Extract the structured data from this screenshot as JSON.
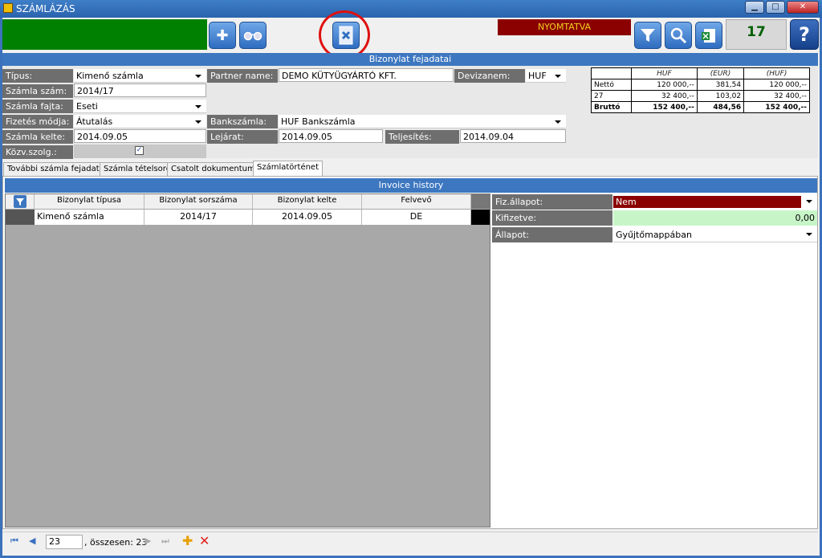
{
  "window": {
    "title": "SZÁMLÁZÁS",
    "min": "▁",
    "max": "□",
    "close": "✕"
  },
  "toolbar": {
    "status": "NYOMTATVA",
    "counter": "17",
    "add_icon": "plus-icon",
    "glasses_icon": "glasses-icon",
    "delete_icon": "delete-document-icon",
    "filter_icon": "filter-icon",
    "search_icon": "search-icon",
    "excel_icon": "excel-icon",
    "help": "?"
  },
  "header": {
    "section_title": "Bizonylat fejadatai",
    "fields": {
      "tipus_label": "Típus:",
      "tipus_value": "Kimenő számla",
      "szamlaszam_label": "Számla szám:",
      "szamlaszam_value": "2014/17",
      "fajta_label": "Számla fajta:",
      "fajta_value": "Eseti",
      "fizetes_label": "Fizetés módja:",
      "fizetes_value": "Átutalás",
      "kelte_label": "Számla kelte:",
      "kelte_value": "2014.09.05",
      "kozv_label": "Közv.szolg.:",
      "kozv_checked": "✓",
      "partner_label": "Partner name:",
      "partner_value": "DEMO KÜTYÜGYÁRTÓ KFT.",
      "deviza_label": "Devizanem:",
      "deviza_value": "HUF",
      "bank_label": "Bankszámla:",
      "bank_value": "HUF Bankszámla",
      "lejarat_label": "Lejárat:",
      "lejarat_value": "2014.09.05",
      "teljesites_label": "Teljesítés:",
      "teljesites_value": "2014.09.04"
    },
    "summary": {
      "headers": [
        "",
        "HUF",
        "(EUR)",
        "(HUF)"
      ],
      "rows": [
        [
          "Nettó",
          "120 000,--",
          "381,54",
          "120 000,--"
        ],
        [
          "27",
          "32 400,--",
          "103,02",
          "32 400,--"
        ],
        [
          "Bruttó",
          "152 400,--",
          "484,56",
          "152 400,--"
        ]
      ]
    }
  },
  "tabs": [
    "További számla fejadatok",
    "Számla tételsorok",
    "Csatolt dokumentumok",
    "Számlatörténet"
  ],
  "history": {
    "section_title": "Invoice history",
    "columns": [
      "Bizonylat típusa",
      "Bizonylat sorszáma",
      "Bizonylat kelte",
      "Felvevő"
    ],
    "rows": [
      [
        "Kimenő számla",
        "2014/17",
        "2014.09.05",
        "DE"
      ]
    ]
  },
  "status_panel": {
    "fiz_label": "Fiz.állapot:",
    "fiz_value": "Nem",
    "kifizetve_label": "Kifizetve:",
    "kifizetve_value": "0,00",
    "allapot_label": "Állapot:",
    "allapot_value": "Gyűjtőmappában"
  },
  "navigator": {
    "position": "23",
    "total_text": ", összesen: 23"
  }
}
